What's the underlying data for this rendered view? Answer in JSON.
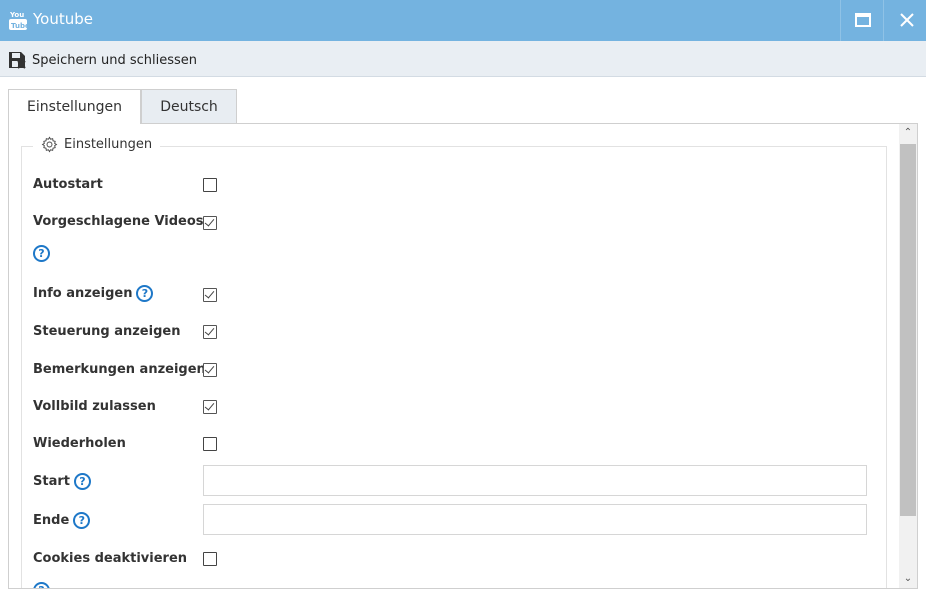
{
  "window": {
    "title": "Youtube",
    "icon": "youtube-icon",
    "maximize_icon": "maximize-icon",
    "close_icon": "close-icon"
  },
  "toolbar": {
    "save_label": "Speichern und schliessen",
    "save_icon": "save-close-icon"
  },
  "tabs": [
    {
      "label": "Einstellungen",
      "active": true
    },
    {
      "label": "Deutsch",
      "active": false
    }
  ],
  "settings": {
    "legend": "Einstellungen",
    "legend_icon": "gear-icon",
    "autostart": {
      "label": "Autostart",
      "checked": false
    },
    "suggested_videos": {
      "label": "Vorgeschlagene Videos",
      "checked": true,
      "help": "?"
    },
    "show_info": {
      "label": "Info anzeigen",
      "checked": true,
      "help": "?"
    },
    "show_controls": {
      "label": "Steuerung anzeigen",
      "checked": true
    },
    "show_annotations": {
      "label": "Bemerkungen anzeigen",
      "checked": true
    },
    "allow_fullscreen": {
      "label": "Vollbild zulassen",
      "checked": true
    },
    "repeat": {
      "label": "Wiederholen",
      "checked": false
    },
    "start": {
      "label": "Start",
      "value": "",
      "help": "?"
    },
    "end": {
      "label": "Ende",
      "value": "",
      "help": "?"
    },
    "disable_cookies": {
      "label": "Cookies deaktivieren",
      "checked": false,
      "help": "?"
    }
  },
  "colors": {
    "titlebar": "#74b3e0",
    "toolbar": "#e9eef3",
    "help_accent": "#1e78c8"
  }
}
